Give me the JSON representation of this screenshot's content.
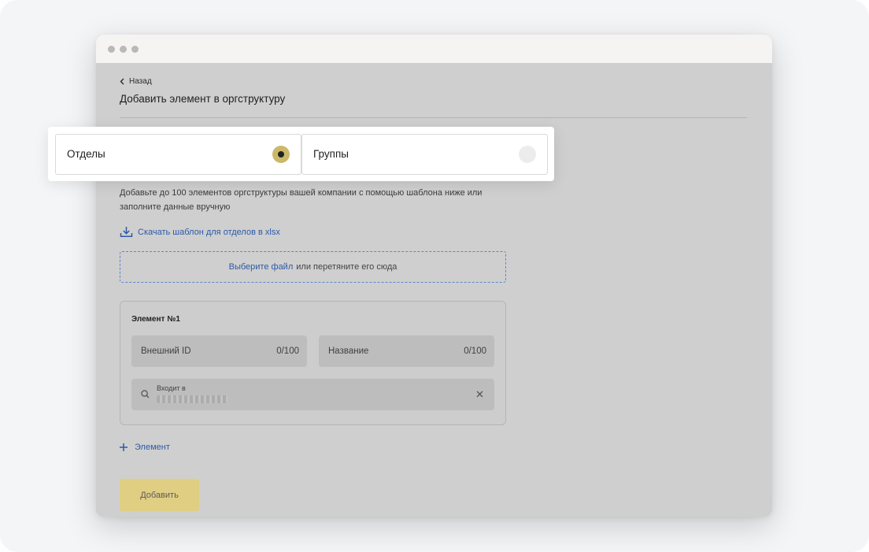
{
  "nav": {
    "back_label": "Назад"
  },
  "page": {
    "title": "Добавить элемент в оргструктуру"
  },
  "type_selector": {
    "options": [
      {
        "label": "Отделы",
        "selected": true
      },
      {
        "label": "Группы",
        "selected": false
      }
    ]
  },
  "description": "Добавьте до 100 элементов оргструктуры вашей компании с помощью шаблона ниже или заполните данные вручную",
  "download": {
    "label": "Скачать шаблон для отделов в xlsx"
  },
  "dropzone": {
    "link": "Выберите файл",
    "text": "или перетяните его сюда"
  },
  "element_card": {
    "title": "Элемент №1",
    "external_id": {
      "placeholder": "Внешний ID",
      "counter": "0/100"
    },
    "name": {
      "placeholder": "Название",
      "counter": "0/100"
    },
    "parent": {
      "label": "Входит в"
    }
  },
  "add_element": {
    "label": "Элемент"
  },
  "submit": {
    "label": "Добавить"
  },
  "colors": {
    "accent_yellow": "#e0ce82",
    "link_blue": "#2d5aa8",
    "radio_selected": "#cbb86a"
  }
}
